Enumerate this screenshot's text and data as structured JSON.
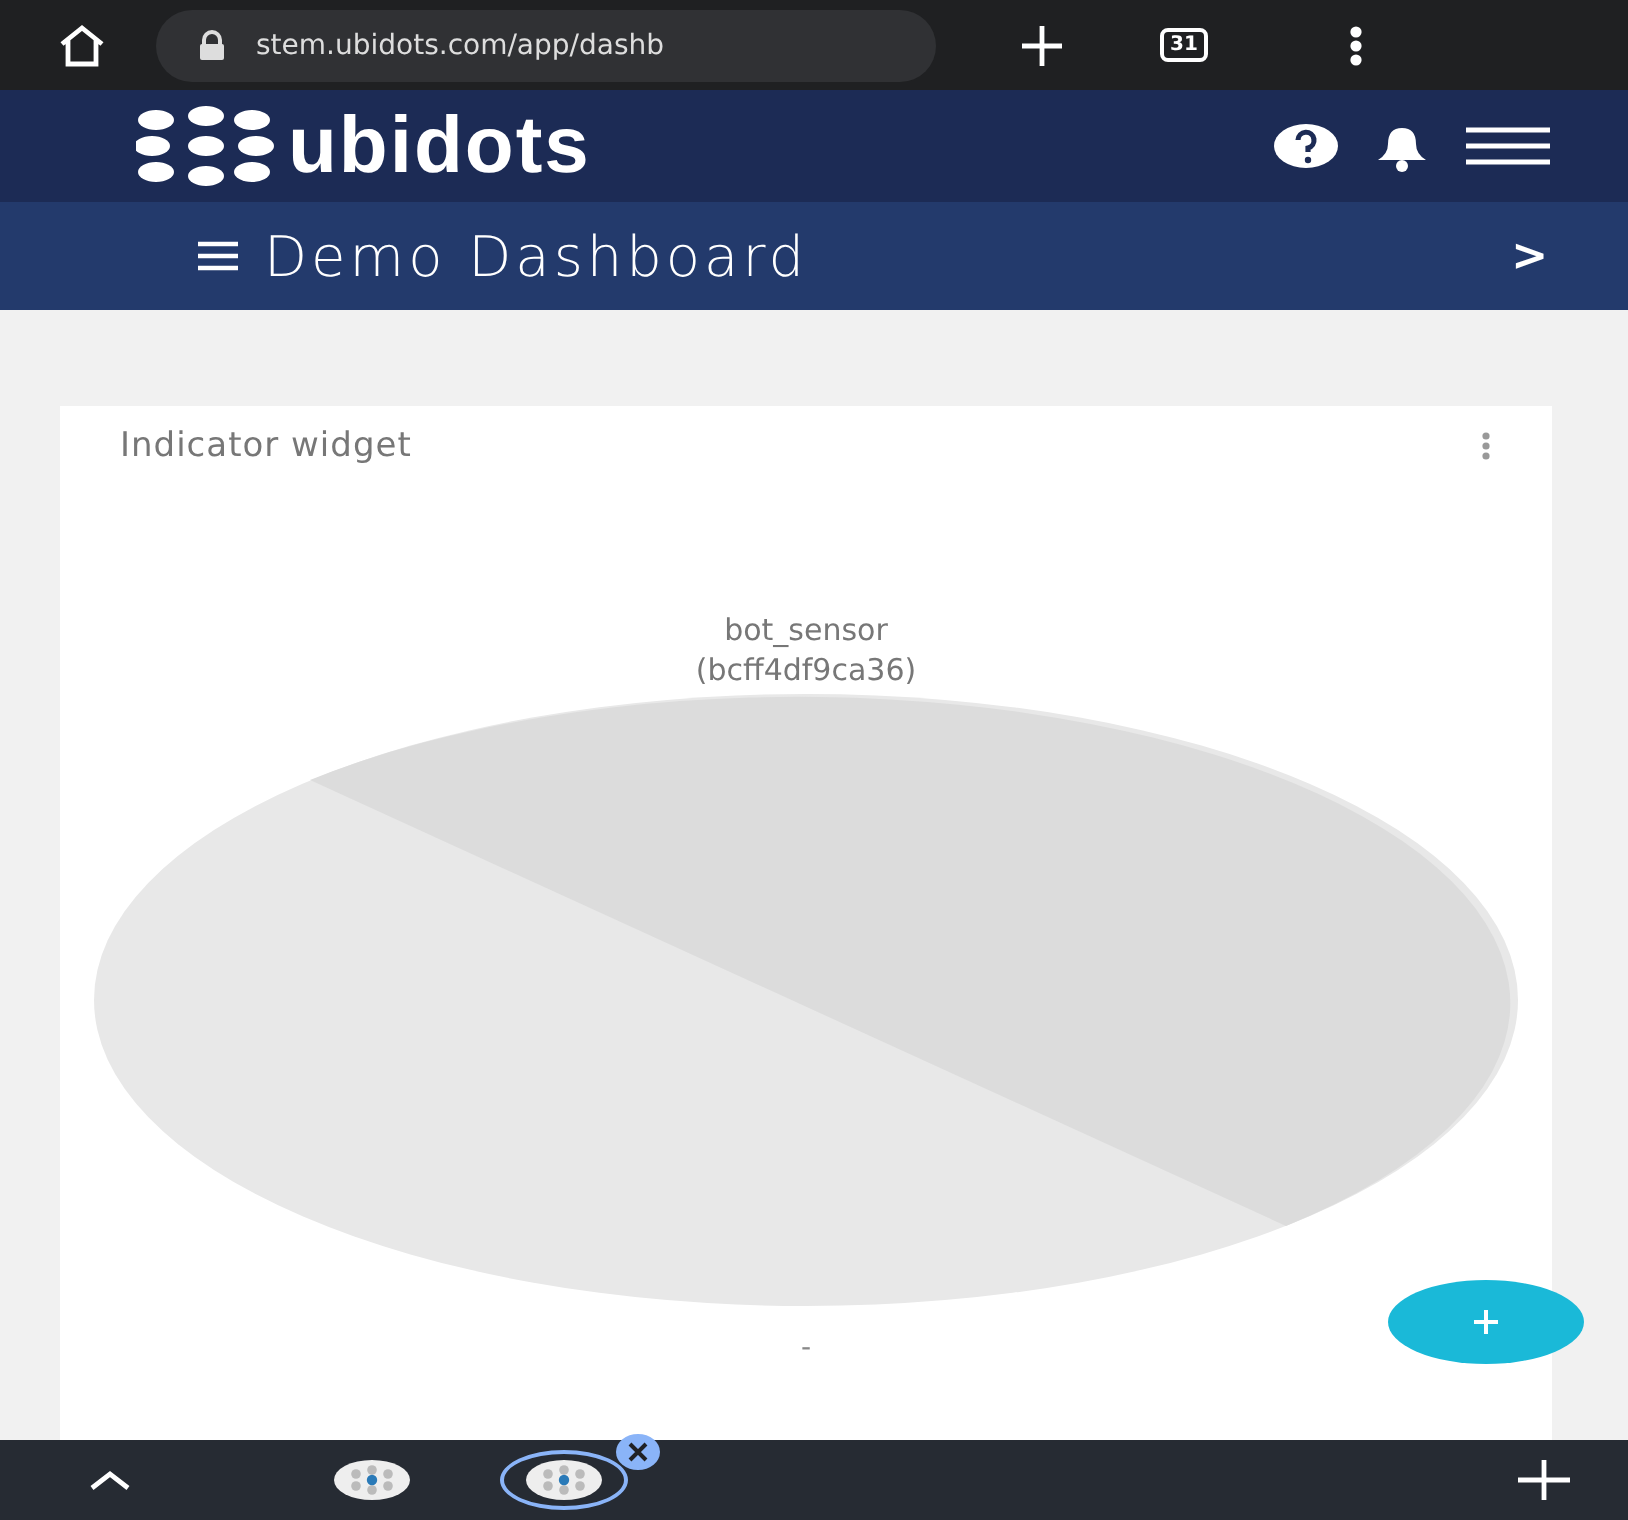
{
  "browser": {
    "url": "stem.ubidots.com/app/dashb",
    "tab_count": "31"
  },
  "header": {
    "logo": "ubidots"
  },
  "dashboard_bar": {
    "title": "Demo Dashboard",
    "next": ">"
  },
  "widget": {
    "title": "Indicator widget",
    "variable": "bot_sensor",
    "device": "(bcff4df9ca36)",
    "value": "-"
  },
  "bottom_tabs": [
    {
      "selected": false
    },
    {
      "selected": true
    }
  ]
}
